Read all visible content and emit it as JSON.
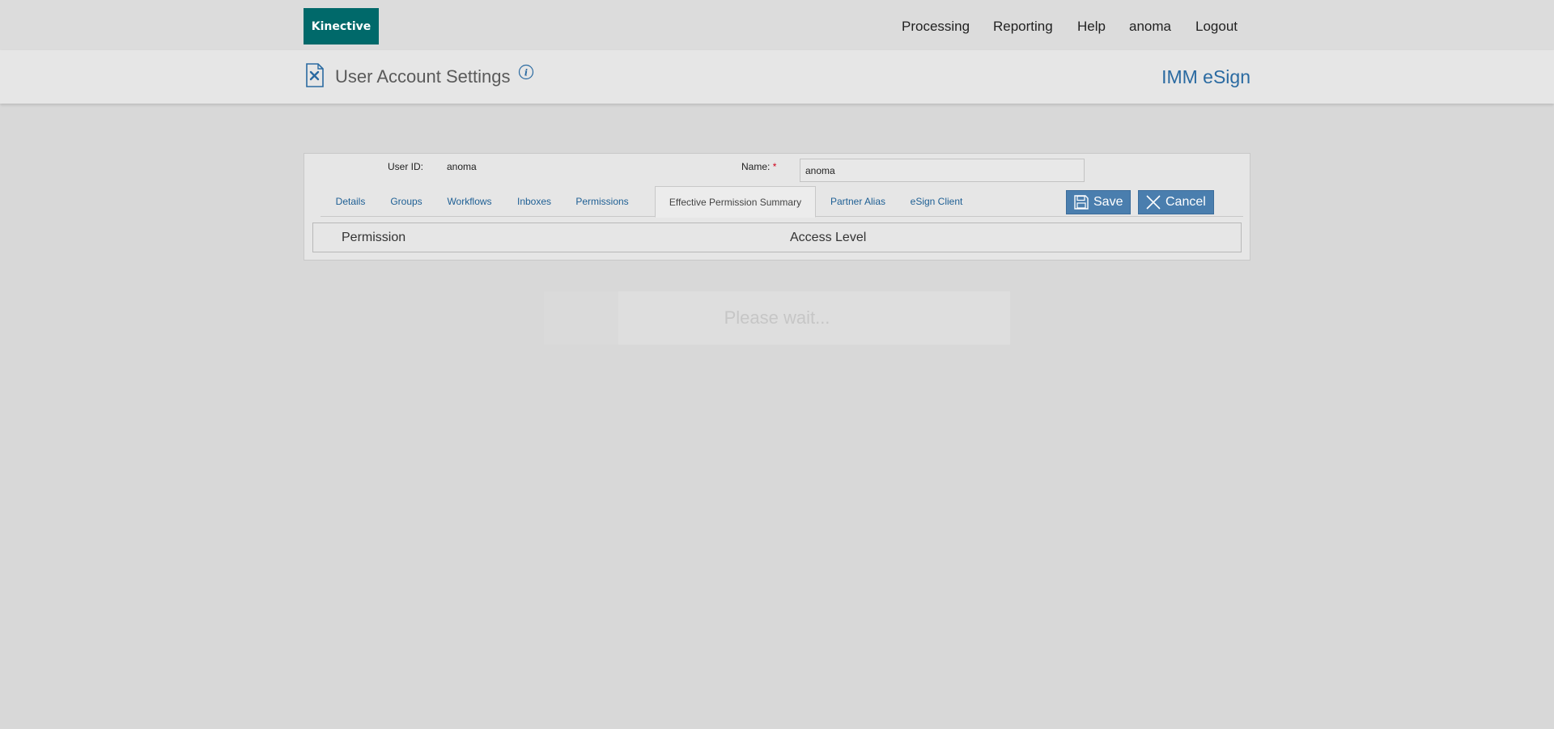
{
  "brand": {
    "logo_text": "Kinective",
    "logo_color": "#00696a"
  },
  "nav": {
    "items": [
      {
        "label": "Processing"
      },
      {
        "label": "Reporting"
      },
      {
        "label": "Help"
      },
      {
        "label": "anoma"
      },
      {
        "label": "Logout"
      }
    ]
  },
  "header": {
    "title": "User Account Settings",
    "app_name": "IMM eSign",
    "page_icon": "document-settings-icon",
    "info_icon": "info-icon"
  },
  "form": {
    "user_id_label": "User ID:",
    "user_id_value": "anoma",
    "name_label": "Name:",
    "name_required_marker": "*",
    "name_value": "anoma"
  },
  "tabs": [
    {
      "label": "Details",
      "active": false
    },
    {
      "label": "Groups",
      "active": false
    },
    {
      "label": "Workflows",
      "active": false
    },
    {
      "label": "Inboxes",
      "active": false
    },
    {
      "label": "Permissions",
      "active": false
    },
    {
      "label": "Effective Permission Summary",
      "active": true
    },
    {
      "label": "Partner Alias",
      "active": false
    },
    {
      "label": "eSign Client",
      "active": false
    }
  ],
  "actions": {
    "save_label": "Save",
    "cancel_label": "Cancel",
    "button_color": "#4a7eae"
  },
  "grid": {
    "columns": [
      "Permission",
      "Access Level"
    ]
  },
  "loading": {
    "text": "Please wait..."
  }
}
